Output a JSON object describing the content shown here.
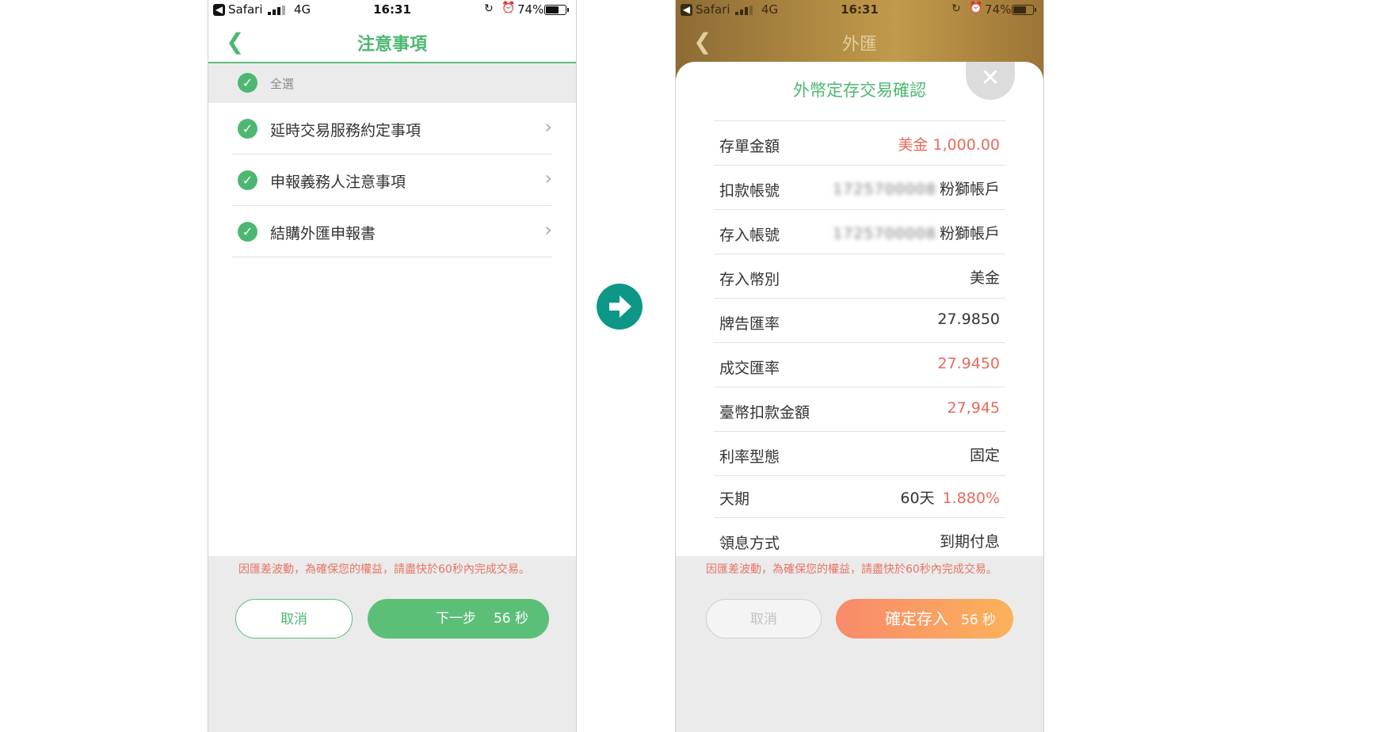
{
  "status_bar": {
    "back_app": "Safari",
    "network": "4G",
    "time": "16:31",
    "battery": "74%",
    "battery_level": 0.74
  },
  "left": {
    "nav_title": "注意事項",
    "select_all": "全選",
    "items": [
      {
        "label": "延時交易服務約定事項"
      },
      {
        "label": "申報義務人注意事項"
      },
      {
        "label": "結購外匯申報書"
      }
    ],
    "footer_note": "因匯差波動，為確保您的權益，請盡快於60秒內完成交易。",
    "cancel": "取消",
    "next": "下一步",
    "countdown": "56 秒"
  },
  "right": {
    "nav_title": "外匯",
    "modal_title": "外幣定存交易確認",
    "rows": {
      "amount": {
        "label": "存單金額",
        "value": "美金 1,000.00"
      },
      "debit_account": {
        "label": "扣款帳號",
        "masked": "1725700008",
        "name": "粉獅帳戶"
      },
      "deposit_account": {
        "label": "存入帳號",
        "masked": "1725700008",
        "name": "粉獅帳戶"
      },
      "currency": {
        "label": "存入幣別",
        "value": "美金"
      },
      "board_rate": {
        "label": "牌告匯率",
        "value": "27.9850"
      },
      "deal_rate": {
        "label": "成交匯率",
        "value": "27.9450"
      },
      "twd_amount": {
        "label": "臺幣扣款金額",
        "value": "27,945"
      },
      "rate_type": {
        "label": "利率型態",
        "value": "固定"
      },
      "term": {
        "label": "天期",
        "days": "60天",
        "rate": "1.880%"
      },
      "interest": {
        "label": "領息方式",
        "value": "到期付息"
      }
    },
    "footer_note": "因匯差波動，為確保您的權益，請盡快於60秒內完成交易。",
    "cancel": "取消",
    "confirm": "確定存入",
    "countdown": "56 秒"
  },
  "colors": {
    "green": "#4db772",
    "red": "#e86a5c",
    "teal": "#0e9786",
    "orange_start": "#f98a6b",
    "orange_end": "#fbb25a"
  },
  "icons": {
    "back": "chevron-left-icon",
    "check": "check-circle-icon",
    "chevron": "chevron-right-icon",
    "close": "close-icon",
    "arrow": "arrow-right-icon"
  }
}
